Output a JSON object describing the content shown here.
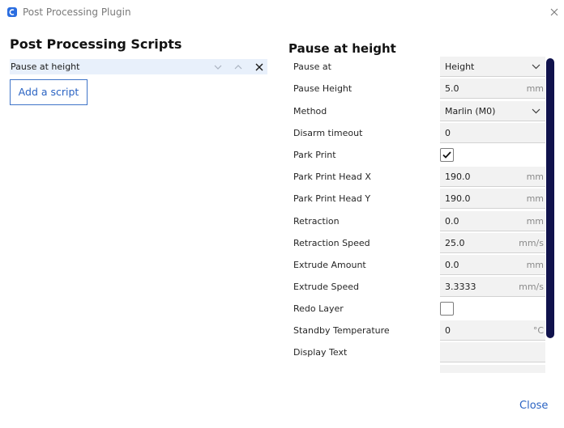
{
  "window": {
    "title": "Post Processing Plugin"
  },
  "left": {
    "heading": "Post Processing Scripts",
    "scripts": [
      {
        "label": "Pause at height"
      }
    ],
    "add_button": "Add a script"
  },
  "right": {
    "heading": "Pause at height",
    "settings": [
      {
        "label": "Pause at",
        "type": "dropdown",
        "value": "Height"
      },
      {
        "label": "Pause Height",
        "type": "number",
        "value": "5.0",
        "unit": "mm"
      },
      {
        "label": "Method",
        "type": "dropdown",
        "value": "Marlin (M0)"
      },
      {
        "label": "Disarm timeout",
        "type": "number",
        "value": "0",
        "unit": ""
      },
      {
        "label": "Park Print",
        "type": "checkbox",
        "checked": true
      },
      {
        "label": "Park Print Head X",
        "type": "number",
        "value": "190.0",
        "unit": "mm"
      },
      {
        "label": "Park Print Head Y",
        "type": "number",
        "value": "190.0",
        "unit": "mm"
      },
      {
        "label": "Retraction",
        "type": "number",
        "value": "0.0",
        "unit": "mm"
      },
      {
        "label": "Retraction Speed",
        "type": "number",
        "value": "25.0",
        "unit": "mm/s"
      },
      {
        "label": "Extrude Amount",
        "type": "number",
        "value": "0.0",
        "unit": "mm"
      },
      {
        "label": "Extrude Speed",
        "type": "number",
        "value": "3.3333",
        "unit": "mm/s"
      },
      {
        "label": "Redo Layer",
        "type": "checkbox",
        "checked": false
      },
      {
        "label": "Standby Temperature",
        "type": "number",
        "value": "0",
        "unit": "°C"
      },
      {
        "label": "Display Text",
        "type": "text",
        "value": ""
      },
      {
        "label": "",
        "type": "text",
        "value": ""
      }
    ]
  },
  "footer": {
    "close_label": "Close"
  },
  "colors": {
    "accent": "#2a63c3",
    "selection": "#e8f0fb",
    "scrollbar": "#10124c"
  },
  "icons": {
    "app": "app-icon",
    "window_close": "close-icon",
    "move_down": "chevron-down-icon",
    "move_up": "chevron-up-icon",
    "remove": "close-icon",
    "dropdown": "chevron-down-icon",
    "checkmark": "checkmark-icon"
  }
}
